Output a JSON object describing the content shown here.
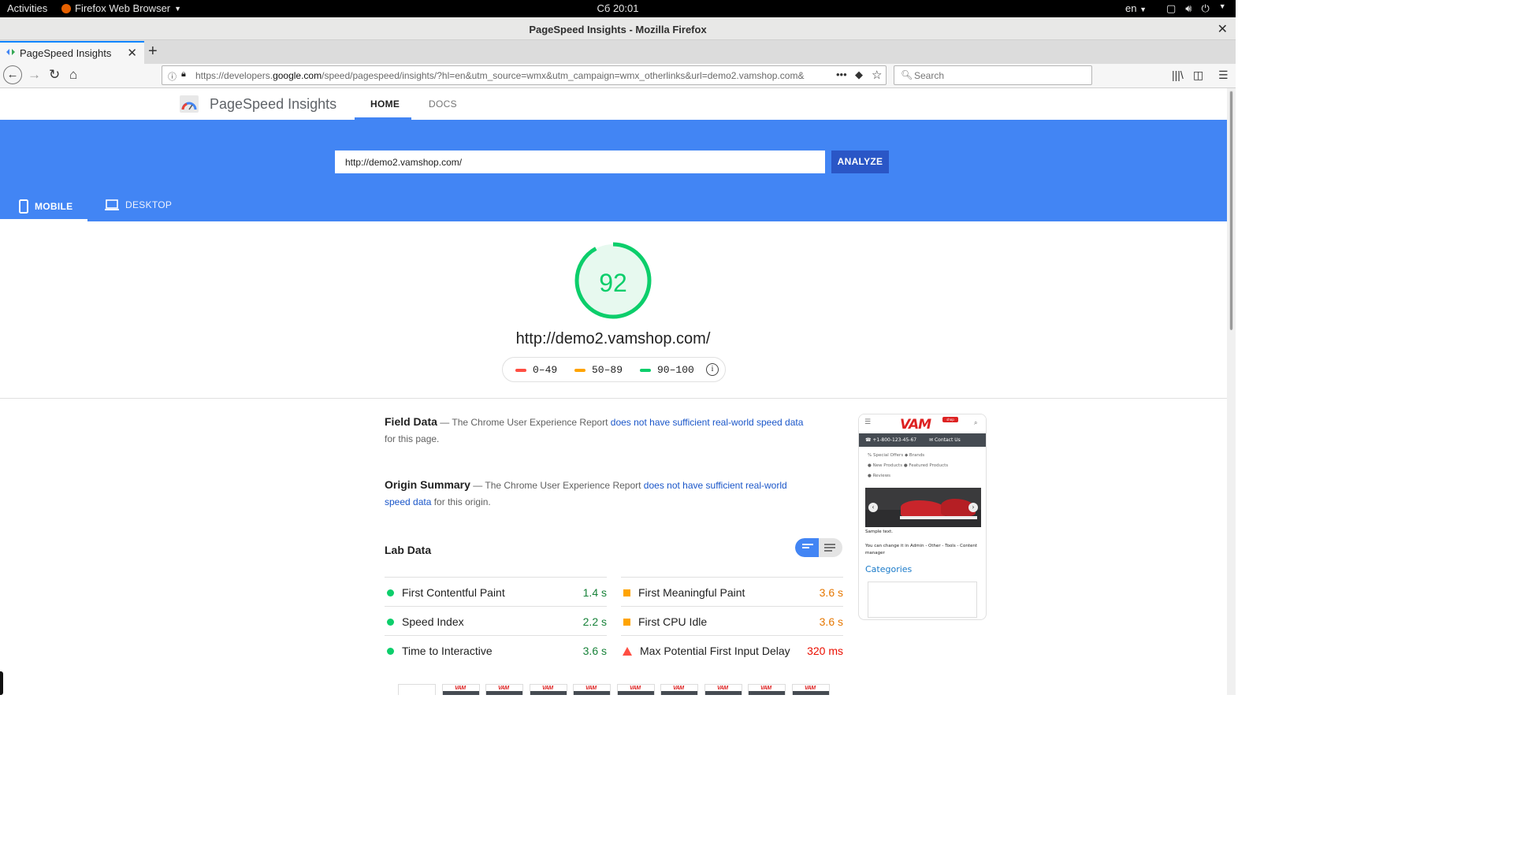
{
  "system": {
    "activities": "Activities",
    "app_name": "Firefox Web Browser",
    "clock": "Сб 20:01",
    "lang": "en"
  },
  "window": {
    "title": "PageSpeed Insights - Mozilla Firefox"
  },
  "tabs": [
    {
      "label": "PageSpeed Insights"
    }
  ],
  "address_bar": {
    "url_prefix": "https://developers.",
    "url_domain": "google.com",
    "url_rest": "/speed/pagespeed/insights/?hl=en&utm_source=wmx&utm_campaign=wmx_otherlinks&url=demo2.vamshop.com&",
    "search_placeholder": "Search"
  },
  "psi": {
    "title": "PageSpeed Insights",
    "nav": {
      "home": "HOME",
      "docs": "DOCS"
    },
    "url_value": "http://demo2.vamshop.com/",
    "analyze": "ANALYZE",
    "device_tabs": {
      "mobile": "MOBILE",
      "desktop": "DESKTOP"
    },
    "score": "92",
    "score_fraction": 0.92,
    "scanned_url": "http://demo2.vamshop.com/",
    "legend": [
      {
        "label": "0–49",
        "color": "#ff4e42"
      },
      {
        "label": "50–89",
        "color": "#ffa400"
      },
      {
        "label": "90–100",
        "color": "#0cce6b"
      }
    ],
    "field_data": {
      "heading": "Field Data",
      "prefix": " — The Chrome User Experience Report ",
      "link": "does not have sufficient real-world speed data",
      "suffix": " for this page."
    },
    "origin_summary": {
      "heading": "Origin Summary",
      "prefix": " — The Chrome User Experience Report ",
      "link": "does not have sufficient real-world speed data",
      "suffix": " for this origin."
    },
    "lab_data": {
      "heading": "Lab Data",
      "metrics_left": [
        {
          "name": "First Contentful Paint",
          "value": "1.4 s",
          "status": "good"
        },
        {
          "name": "Speed Index",
          "value": "2.2 s",
          "status": "good"
        },
        {
          "name": "Time to Interactive",
          "value": "3.6 s",
          "status": "good"
        }
      ],
      "metrics_right": [
        {
          "name": "First Meaningful Paint",
          "value": "3.6 s",
          "status": "average"
        },
        {
          "name": "First CPU Idle",
          "value": "3.6 s",
          "status": "average"
        },
        {
          "name": "Max Potential First Input Delay",
          "value": "320 ms",
          "status": "poor"
        }
      ]
    },
    "screenshot": {
      "logo": "VAM",
      "tag": "shop",
      "phone": "+1-800-123-45-67",
      "contact": "Contact Us",
      "links": [
        "Special Offers",
        "Brands",
        "New Products",
        "Featured Products",
        "Reviews"
      ],
      "text1": "Sample text.",
      "text2": "You can change it in Admin - Other - Tools - Content manager",
      "categories": "Categories"
    }
  },
  "colors": {
    "brand_blue": "#4285f4",
    "analyze_blue": "#2a56c6",
    "good": "#0cce6b",
    "average": "#ffa400",
    "poor": "#ff4e42"
  }
}
